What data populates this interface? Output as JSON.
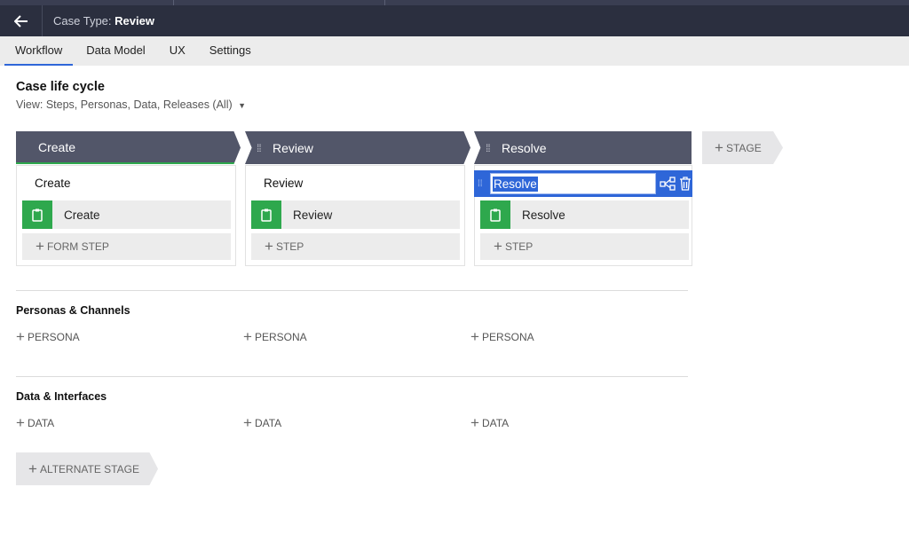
{
  "header": {
    "case_type_label": "Case Type:",
    "case_type_name": "Review"
  },
  "tabs": [
    {
      "label": "Workflow",
      "active": true
    },
    {
      "label": "Data Model",
      "active": false
    },
    {
      "label": "UX",
      "active": false
    },
    {
      "label": "Settings",
      "active": false
    }
  ],
  "page": {
    "title": "Case life cycle",
    "view_selector": "View: Steps, Personas, Data, Releases (All)"
  },
  "stages": [
    {
      "header": "Create",
      "process_name": "Create",
      "step": "Create",
      "add_step_label": "FORM STEP"
    },
    {
      "header": "Review",
      "process_name": "Review",
      "step": "Review",
      "add_step_label": "STEP"
    },
    {
      "header": "Resolve",
      "process_name": "Resolve",
      "step": "Resolve",
      "add_step_label": "STEP"
    }
  ],
  "add_stage_label": "STAGE",
  "personas_section": {
    "title": "Personas & Channels",
    "add_label": "PERSONA"
  },
  "data_section": {
    "title": "Data & Interfaces",
    "add_label": "DATA"
  },
  "alternate_stage_label": "ALTERNATE STAGE",
  "colors": {
    "header_bg": "#2b2f3f",
    "stage_bg": "#525669",
    "step_icon_green": "#2ea84d",
    "accent_blue": "#2e66d8",
    "active_stage_underline": "#2ea84d"
  },
  "icons": {
    "back": "arrow-left-icon",
    "step": "clipboard-icon",
    "add": "plus-icon",
    "view_dropdown": "caret-down-icon",
    "edit_flow": "flow-icon",
    "delete": "trash-icon"
  }
}
